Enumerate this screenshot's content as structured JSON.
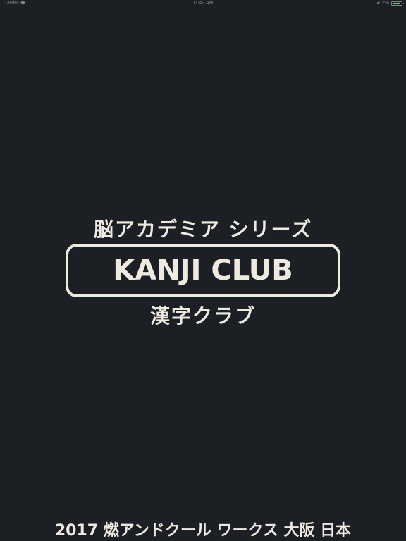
{
  "status_bar": {
    "carrier": "Carrier",
    "time": "11:43 AM",
    "battery_percent": "2%",
    "battery_level": 0.9,
    "battery_color": "#4cd964"
  },
  "logo": {
    "subtitle": "脳アカデミア シリーズ",
    "title": "KANJI CLUB",
    "kanji_title": "漢字クラブ"
  },
  "footer": {
    "credit": "2017 燃アンドクール ワークス 大阪 日本"
  },
  "colors": {
    "background": "#1c1f24",
    "foreground": "#eeeae2"
  }
}
